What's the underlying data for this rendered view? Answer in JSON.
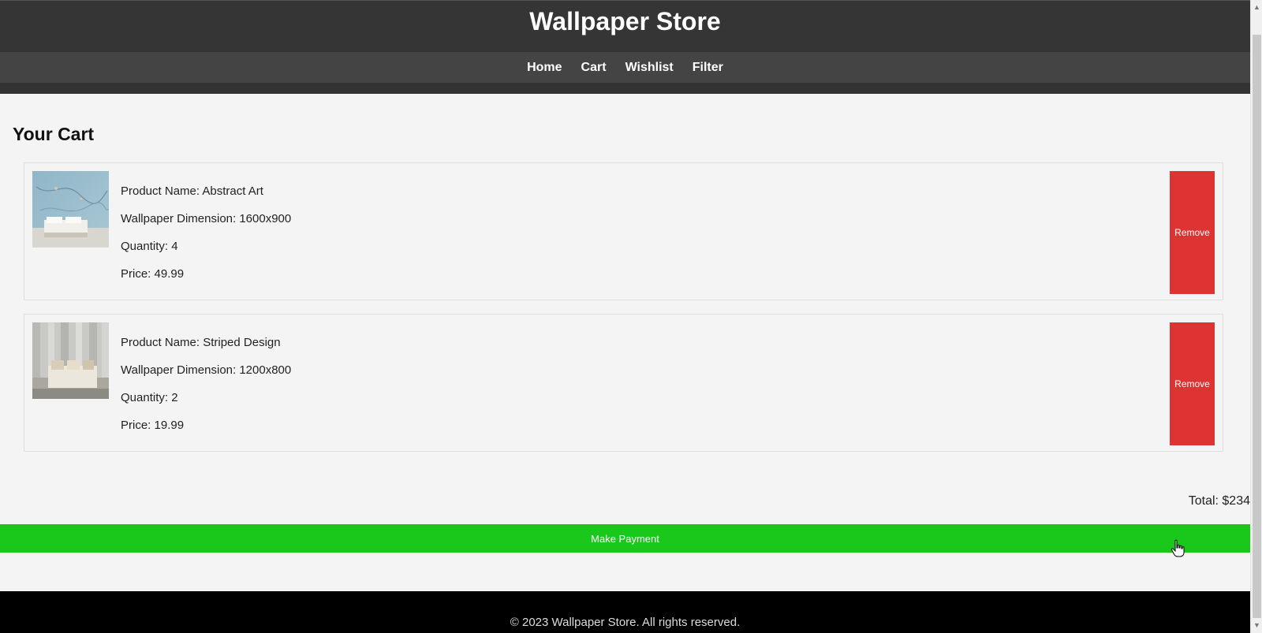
{
  "header": {
    "title": "Wallpaper Store"
  },
  "nav": {
    "items": [
      "Home",
      "Cart",
      "Wishlist",
      "Filter"
    ]
  },
  "cart": {
    "title": "Your Cart",
    "items": [
      {
        "name_text": "Product Name: Abstract Art",
        "dimension_text": "Wallpaper Dimension: 1600x900",
        "quantity_text": "Quantity: 4",
        "price_text": "Price: 49.99",
        "remove_label": "Remove",
        "thumb_icon": "abstract-wallpaper-thumbnail"
      },
      {
        "name_text": "Product Name: Striped Design",
        "dimension_text": "Wallpaper Dimension: 1200x800",
        "quantity_text": "Quantity: 2",
        "price_text": "Price: 19.99",
        "remove_label": "Remove",
        "thumb_icon": "striped-wallpaper-thumbnail"
      }
    ],
    "total_text": "Total: $234",
    "pay_label": "Make Payment"
  },
  "footer": {
    "text": "© 2023 Wallpaper Store. All rights reserved."
  },
  "colors": {
    "header_bg": "#353535",
    "nav_bg": "#444444",
    "remove_bg": "#dd3333",
    "pay_bg": "#19c81b",
    "footer_bg": "#000000"
  }
}
